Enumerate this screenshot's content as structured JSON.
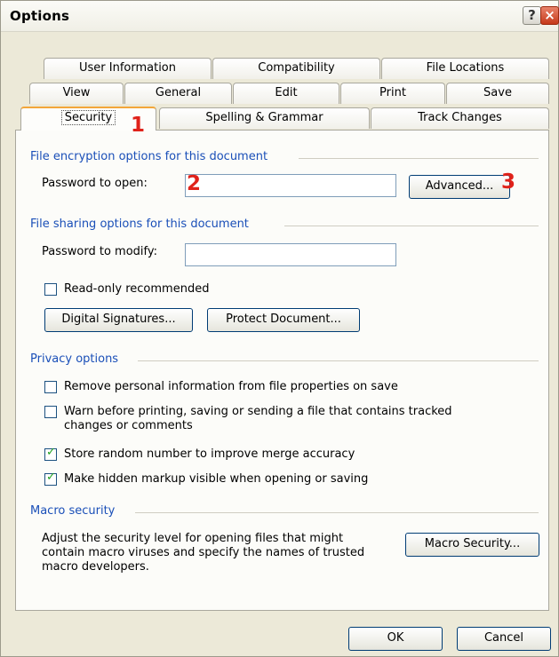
{
  "window": {
    "title": "Options",
    "help_glyph": "?",
    "close_glyph": "×"
  },
  "tabs": {
    "row1": [
      "User Information",
      "Compatibility",
      "File Locations"
    ],
    "row2": [
      "View",
      "General",
      "Edit",
      "Print",
      "Save"
    ],
    "row3": [
      "Security",
      "Spelling & Grammar",
      "Track Changes"
    ],
    "active": "Security"
  },
  "encryption": {
    "heading": "File encryption options for this document",
    "password_open_label": "Password to open:",
    "password_open_value": "",
    "advanced_button": "Advanced..."
  },
  "sharing": {
    "heading": "File sharing options for this document",
    "password_modify_label": "Password to modify:",
    "password_modify_value": "",
    "readonly_label": "Read-only recommended",
    "readonly_checked": false,
    "digital_signatures_button": "Digital Signatures...",
    "protect_document_button": "Protect Document..."
  },
  "privacy": {
    "heading": "Privacy options",
    "options": [
      {
        "label": "Remove personal information from file properties on save",
        "checked": false
      },
      {
        "label": "Warn before printing, saving or sending a file that contains tracked changes or comments",
        "checked": false
      },
      {
        "label": "Store random number to improve merge accuracy",
        "checked": true
      },
      {
        "label": "Make hidden markup visible when opening or saving",
        "checked": true
      }
    ]
  },
  "macro": {
    "heading": "Macro security",
    "description": "Adjust the security level for opening files that might contain macro viruses and specify the names of trusted macro developers.",
    "button": "Macro Security..."
  },
  "footer": {
    "ok_button": "OK",
    "cancel_button": "Cancel"
  },
  "annotations": {
    "marker1": "1",
    "marker2": "2",
    "marker3": "3",
    "color": "#e0221a"
  }
}
